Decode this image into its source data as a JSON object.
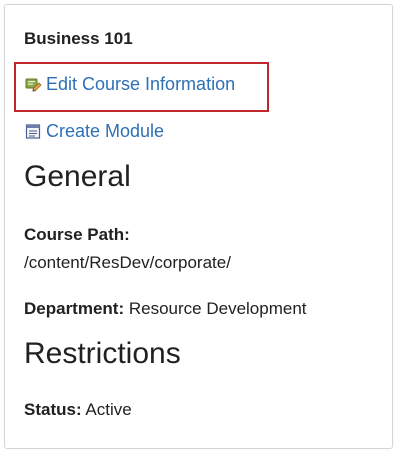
{
  "course": {
    "title": "Business 101"
  },
  "actions": {
    "edit_label": "Edit Course Information",
    "edit_icon": "edit-course-icon",
    "module_label": "Create Module",
    "module_icon": "create-module-icon",
    "highlight_color": "#c0272d",
    "link_color": "#2d70b6"
  },
  "general": {
    "heading": "General",
    "course_path_label": "Course Path:",
    "course_path_value": "/content/ResDev/corporate/",
    "department_label": "Department:",
    "department_value": "Resource Development"
  },
  "restrictions": {
    "heading": "Restrictions",
    "status_label": "Status:",
    "status_value": "Active"
  }
}
